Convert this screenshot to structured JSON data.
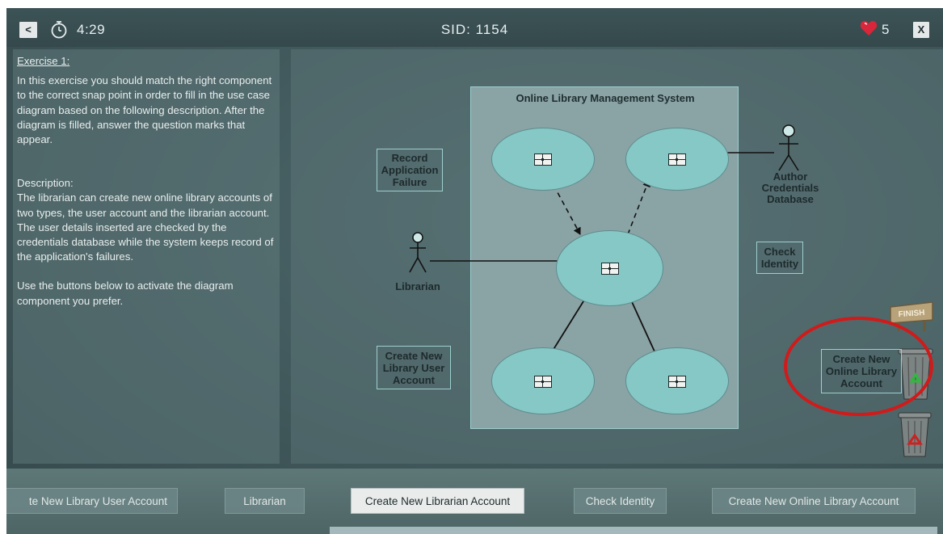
{
  "header": {
    "back_label": "<",
    "timer": "4:29",
    "sid": "SID: 1154",
    "lives": "5",
    "close_label": "X"
  },
  "exercise": {
    "title": "Exercise 1:",
    "intro": "In this exercise you should match the right component to the correct snap point in order to fill in the use case diagram based on the following description. After the diagram is filled, answer the question marks that appear.",
    "description_heading": "Description:",
    "description": "The librarian can create new online library accounts of two types, the user account and the librarian account. The user details inserted are checked by the credentials database while the system keeps record of the application's failures.",
    "instruction": "Use the buttons below to activate the diagram component you prefer."
  },
  "diagram": {
    "system_title": "Online Library Management System",
    "floating_labels": {
      "record_failure": "Record Application Failure",
      "check_identity": "Check Identity",
      "create_user_account": "Create New Library User Account",
      "create_online_account": "Create New Online Library Account"
    },
    "actors": {
      "librarian": "Librarian",
      "author_db": "Author Credentials Database"
    }
  },
  "tools": {
    "finish_label": "FINISH"
  },
  "component_buttons": [
    {
      "label": "te New Library User Account",
      "active": false
    },
    {
      "label": "Librarian",
      "active": false
    },
    {
      "label": "Create New Librarian Account",
      "active": true
    },
    {
      "label": "Check Identity",
      "active": false
    },
    {
      "label": "Create New Online Library Account",
      "active": false
    }
  ],
  "colors": {
    "usecase_fill": "#86c8c6",
    "highlight_ring": "#d11a1a",
    "lives_heart": "#d8263a"
  }
}
